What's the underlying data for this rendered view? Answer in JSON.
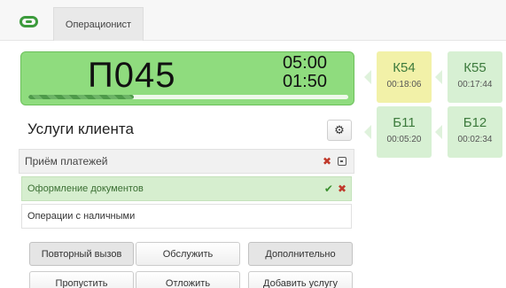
{
  "header": {
    "role_tab_label": "Операционист"
  },
  "current_ticket": {
    "number": "П045",
    "timer_1": "05:00",
    "timer_2": "01:50",
    "progress_fraction": 0.33
  },
  "queue": [
    {
      "code": "К54",
      "time": "00:18:06",
      "highlighted": true
    },
    {
      "code": "К55",
      "time": "00:17:44",
      "highlighted": false
    },
    {
      "code": "Б11",
      "time": "00:05:20",
      "highlighted": false
    },
    {
      "code": "Б12",
      "time": "00:02:34",
      "highlighted": false
    }
  ],
  "services": {
    "title": "Услуги клиента",
    "group_label": "Приём платежей",
    "items": [
      {
        "label": "Оформление документов",
        "selected": true
      },
      {
        "label": "Операции с наличными",
        "selected": false
      }
    ]
  },
  "actions": {
    "recall": "Повторный вызов",
    "serve": "Обслужить",
    "more": "Дополнительно",
    "skip": "Пропустить",
    "postpone": "Отложить",
    "add_service": "Добавить услугу"
  },
  "colors": {
    "accent_green": "#8fdc7e",
    "tile_green": "#d7f0d3",
    "tile_highlight": "#f2f1a8",
    "remove_red": "#c0392b"
  },
  "icons": {
    "logo": "logo-icon",
    "settings": "gear-icon",
    "remove": "close-icon",
    "confirm": "check-icon",
    "collapse": "collapse-icon"
  }
}
